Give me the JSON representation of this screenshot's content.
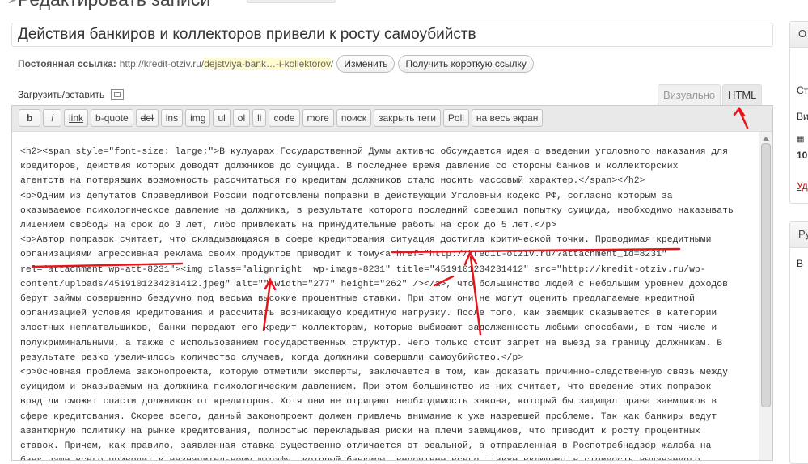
{
  "page": {
    "heading": "Редактировать записи"
  },
  "post": {
    "title": "Действия банкиров и коллекторов привели к росту самоубийств"
  },
  "permalink": {
    "label": "Постоянная ссылка:",
    "url_base": "http://kredit-otziv.ru/",
    "slug": "dejstviya-bank…-i-kollektorov",
    "url_end": "/",
    "edit_button": "Изменить",
    "shortlink_button": "Получить короткую ссылку"
  },
  "upload": {
    "label": "Загрузить/вставить",
    "icon": "media-icon"
  },
  "tabs": {
    "visual": "Визуально",
    "html": "HTML"
  },
  "toolbar": {
    "buttons": [
      {
        "key": "b",
        "label": "b"
      },
      {
        "key": "i",
        "label": "i"
      },
      {
        "key": "link",
        "label": "link"
      },
      {
        "key": "b-quote",
        "label": "b-quote"
      },
      {
        "key": "del",
        "label": "del"
      },
      {
        "key": "ins",
        "label": "ins"
      },
      {
        "key": "img",
        "label": "img"
      },
      {
        "key": "ul",
        "label": "ul"
      },
      {
        "key": "ol",
        "label": "ol"
      },
      {
        "key": "li",
        "label": "li"
      },
      {
        "key": "code",
        "label": "code"
      },
      {
        "key": "more",
        "label": "more"
      },
      {
        "key": "search",
        "label": "поиск"
      },
      {
        "key": "close-tags",
        "label": "закрыть теги"
      },
      {
        "key": "poll",
        "label": "Poll"
      },
      {
        "key": "fullscreen",
        "label": "на весь экран"
      }
    ]
  },
  "editor": {
    "lines": [
      "<h2><span style=\"font-size: large;\">В кулуарах Государственной Думы активно обсуждается идея о введении уголовного наказания для",
      "кредиторов, действия которых доводят должников до суицида. В последнее время давление со стороны банков и коллекторских",
      "агентств на потерявших возможность рассчитаться по кредитам должников стало носить массовый характер.</span></h2>",
      "<p>Одним из депутатов Справедливой России подготовлены поправки в действующий Уголовный кодекс РФ, согласно которым за",
      "оказываемое психологическое давление на должника, в результате которого последний совершил попытку суицида, необходимо наказывать",
      "лишением свободы на срок до 3 лет, либо привлекать на принудительные работы на срок до 5 лет.</p>",
      "<p>Автор поправок считает, что складывающаяся в сфере кредитования ситуация достигла критической точки. Проводимая кредитными",
      "организациями агрессивная реклама своих продуктов приводит к тому<a href=\"http://kredit-otziv.ru/?attachment_id=8231\"",
      "rel=\"attachment wp-att-8231\"><img class=\"alignright  wp-image-8231\" title=\"4519101234231412\" src=\"http://kredit-otziv.ru/wp-",
      "content/uploads/4519101234231412.jpeg\" alt=\"\" width=\"277\" height=\"262\" /></a>, что большинство людей с небольшим уровнем доходов",
      "берут займы совершенно бездумно под весьма высокие процентные ставки. При этом они не могут оценить предлагаемые кредитной",
      "организацией условия кредитования и рассчитать возникающую кредитную нагрузку. После того, как заемщик оказывается в категории",
      "злостных неплательщиков, банки передают его кредит коллекторам, которые выбивают задолженность любыми способами, в том числе и",
      "полукриминальными, а также с использованием государственных структур. Чего только стоит запрет на выезд за границу должникам. В",
      "результате резко увеличилось количество случаев, когда должники совершали самоубийство.</p>",
      "<p>Основная проблема законопроекта, которую отметили эксперты, заключается в том, как доказать причинно-следственную связь между",
      "суицидом и оказываемым на должника психологическим давлением. При этом большинство из них считает, что введение этих поправок",
      "вряд ли сможет спасти должников от кредиторов. Хотя они не отрицают необходимость закона, который бы защищал права заемщиков в",
      "сфере кредитования. Скорее всего, данный законопроект должен привлечь внимание к уже назревшей проблеме. Так как банкиры ведут",
      "авантюрную политику на рынке кредитования, полностью перекладывая риски на плечи заемщиков, что приводит к росту процентных",
      "ставок. Причем, как правило, заявленная ставка существенно отличается от реальной, а отправленная в Роспотребнадзор жалоба на",
      "банк чаще всего приводит к незначительному штрафу, который банкиры, вероятнее всего, также включают в стоимость выдаваемого"
    ]
  },
  "sidebar": {
    "box1_header": "О",
    "box1_items": [
      "Ст",
      "Ви",
      "10",
      "Уд"
    ],
    "box2_header": "Ру",
    "box2_item": "В"
  },
  "annotations": {
    "color": "#e8141c"
  }
}
